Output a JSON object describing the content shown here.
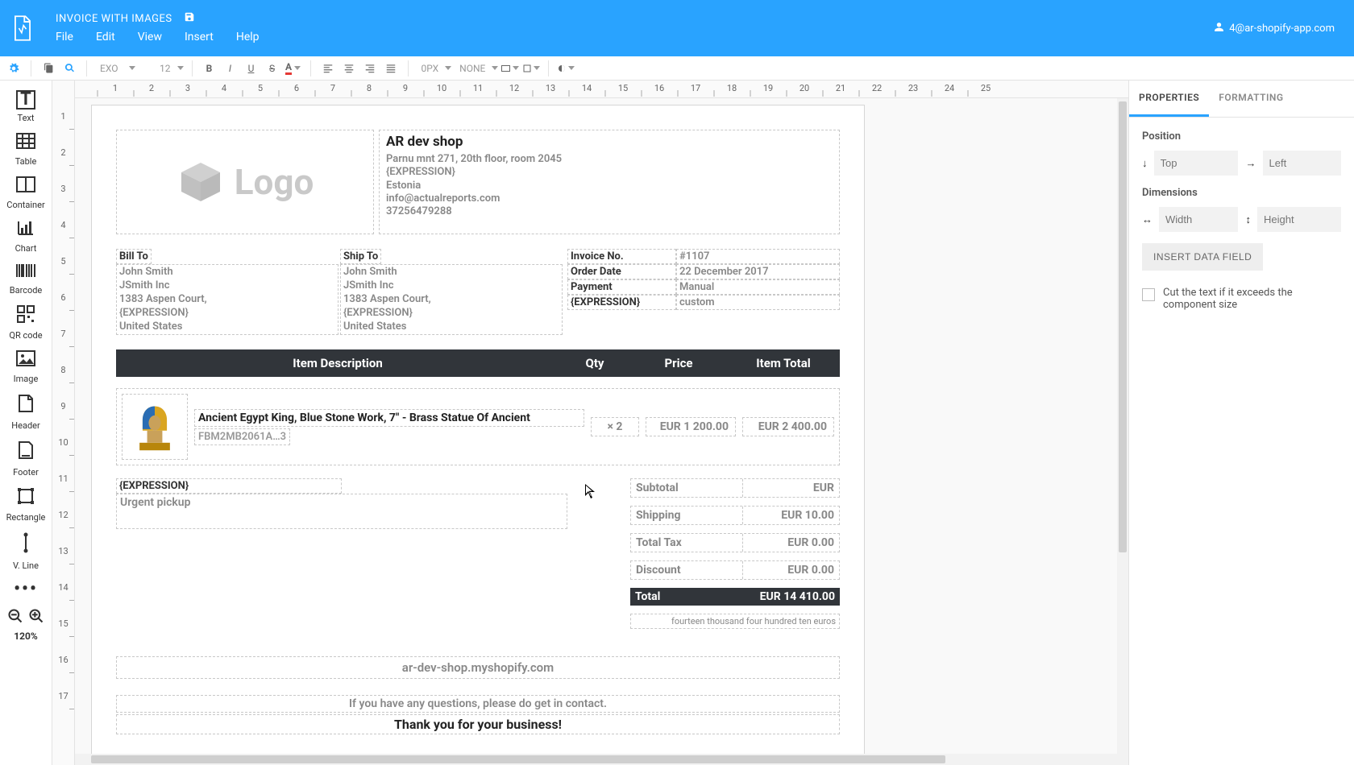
{
  "header": {
    "doc_title": "INVOICE WITH IMAGES",
    "menu": {
      "file": "File",
      "edit": "Edit",
      "view": "View",
      "insert": "Insert",
      "help": "Help"
    },
    "user": "4@ar-shopify-app.com"
  },
  "toolbar": {
    "font_name": "EXO",
    "font_size": "12",
    "border_size": "0PX",
    "border_style": "NONE"
  },
  "palette": {
    "text": "Text",
    "table": "Table",
    "container": "Container",
    "chart": "Chart",
    "barcode": "Barcode",
    "qrcode": "QR code",
    "image": "Image",
    "header": "Header",
    "footer": "Footer",
    "rectangle": "Rectangle",
    "vline": "V. Line",
    "zoom": "120%"
  },
  "ruler_h": [
    "1",
    "2",
    "3",
    "4",
    "5",
    "6",
    "7",
    "8",
    "9",
    "10",
    "11",
    "12",
    "13",
    "14",
    "15",
    "16",
    "17",
    "18",
    "19",
    "20",
    "21",
    "22",
    "23",
    "24",
    "25"
  ],
  "ruler_v": [
    "1",
    "2",
    "3",
    "4",
    "5",
    "6",
    "7",
    "8",
    "9",
    "10",
    "11",
    "12",
    "13",
    "14",
    "15",
    "16",
    "17"
  ],
  "invoice": {
    "logo_text": "Logo",
    "shop": {
      "name": "AR dev shop",
      "addr1": "Parnu mnt 271, 20th floor, room 2045",
      "expr": "{EXPRESSION}",
      "country": "Estonia",
      "email": "info@actualreports.com",
      "phone": "37256479288"
    },
    "bill_label": "Bill To",
    "ship_label": "Ship To",
    "bill": {
      "name": "John Smith",
      "company": "JSmith Inc",
      "addr": "1383 Aspen Court,",
      "expr": "{EXPRESSION}",
      "country": "United States"
    },
    "ship": {
      "name": "John Smith",
      "company": "JSmith Inc",
      "addr": "1383 Aspen Court,",
      "expr": "{EXPRESSION}",
      "country": "United States"
    },
    "meta": {
      "invoice_no_k": "Invoice No.",
      "invoice_no_v": "#1107",
      "order_date_k": "Order Date",
      "order_date_v": "22 December 2017",
      "payment_k": "Payment",
      "payment_v": "Manual",
      "expr_k": "{EXPRESSION}",
      "expr_v": "custom"
    },
    "thead": {
      "desc": "Item Description",
      "qty": "Qty",
      "price": "Price",
      "total": "Item Total"
    },
    "item": {
      "title": "Ancient Egypt King, Blue Stone Work, 7\" - Brass Statue Of Ancient",
      "sku": "FBM2MB2061A…3",
      "qty": "× 2",
      "price": "EUR 1 200.00",
      "total": "EUR 2 400.00"
    },
    "note_expr": "{EXPRESSION}",
    "note_body": "Urgent pickup",
    "totals": {
      "subtotal_k": "Subtotal",
      "subtotal_v": "EUR",
      "shipping_k": "Shipping",
      "shipping_v": "EUR 10.00",
      "tax_k": "Total Tax",
      "tax_v": "EUR 0.00",
      "discount_k": "Discount",
      "discount_v": "EUR 0.00",
      "total_k": "Total",
      "total_v": "EUR 14 410.00",
      "words": "fourteen thousand four hundred ten euros"
    },
    "footer_url": "ar-dev-shop.myshopify.com",
    "footer_q": "If you have any questions, please do get in contact.",
    "footer_thanks": "Thank you for your business!"
  },
  "panel": {
    "tab_props": "PROPERTIES",
    "tab_fmt": "FORMATTING",
    "position": "Position",
    "top": "Top",
    "left": "Left",
    "dimensions": "Dimensions",
    "width": "Width",
    "height": "Height",
    "insert_btn": "INSERT DATA FIELD",
    "cut_text": "Cut the text if it exceeds the component size"
  }
}
